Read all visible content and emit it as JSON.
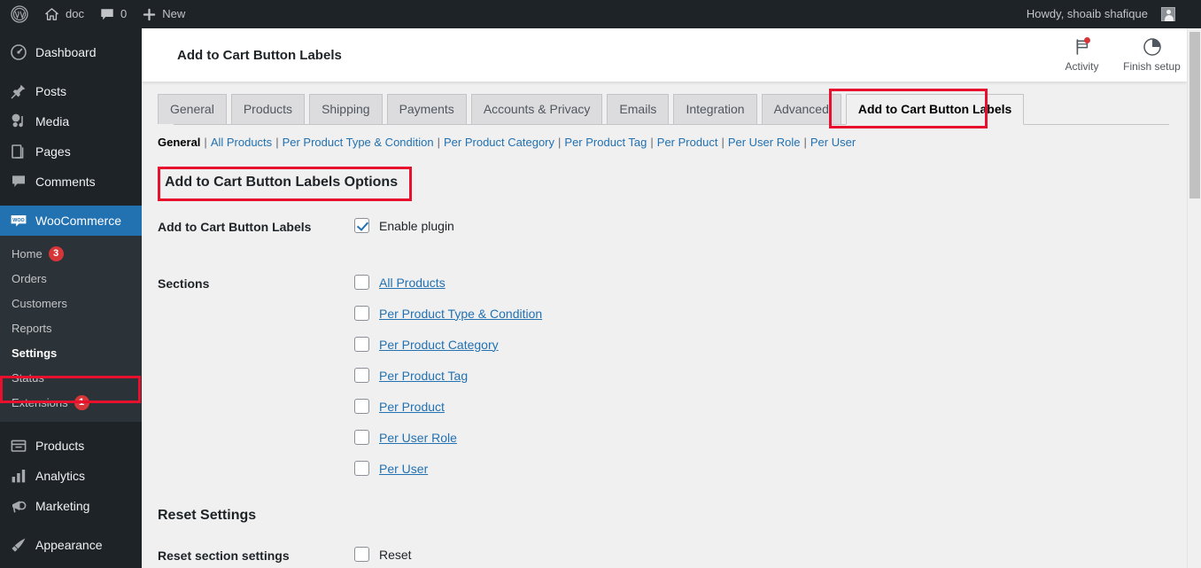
{
  "adminbar": {
    "logo_icon": "wordpress-logo-icon",
    "site_name": "doc",
    "comments_icon": "comment-bubble-icon",
    "comments_count": "0",
    "new_label": "New",
    "howdy": "Howdy, shoaib shafique",
    "avatar_icon": "user-avatar-icon"
  },
  "sidebar": {
    "items": [
      {
        "label": "Dashboard",
        "icon": "dashboard-icon"
      },
      {
        "label": "Posts",
        "icon": "pin-icon"
      },
      {
        "label": "Media",
        "icon": "media-icon"
      },
      {
        "label": "Pages",
        "icon": "pages-icon"
      },
      {
        "label": "Comments",
        "icon": "comment-bubble-icon"
      },
      {
        "label": "WooCommerce",
        "icon": "woocommerce-icon"
      }
    ],
    "submenu": [
      {
        "label": "Home",
        "badge": "3"
      },
      {
        "label": "Orders",
        "badge": ""
      },
      {
        "label": "Customers",
        "badge": ""
      },
      {
        "label": "Reports",
        "badge": ""
      },
      {
        "label": "Settings",
        "badge": ""
      },
      {
        "label": "Status",
        "badge": ""
      },
      {
        "label": "Extensions",
        "badge": "1"
      }
    ],
    "items_bottom": [
      {
        "label": "Products",
        "icon": "products-box-icon"
      },
      {
        "label": "Analytics",
        "icon": "bar-chart-icon"
      },
      {
        "label": "Marketing",
        "icon": "megaphone-icon"
      },
      {
        "label": "Appearance",
        "icon": "paintbrush-icon"
      }
    ]
  },
  "header": {
    "title": "Add to Cart Button Labels",
    "activity_label": "Activity",
    "activity_icon": "flag-icon",
    "finish_setup_label": "Finish setup",
    "finish_setup_icon": "pie-progress-icon"
  },
  "tabs": [
    {
      "label": "General",
      "active": false
    },
    {
      "label": "Products",
      "active": false
    },
    {
      "label": "Shipping",
      "active": false
    },
    {
      "label": "Payments",
      "active": false
    },
    {
      "label": "Accounts & Privacy",
      "active": false
    },
    {
      "label": "Emails",
      "active": false
    },
    {
      "label": "Integration",
      "active": false
    },
    {
      "label": "Advanced",
      "active": false
    },
    {
      "label": "Add to Cart Button Labels",
      "active": true
    }
  ],
  "subnav": [
    {
      "label": "General",
      "current": true
    },
    {
      "label": "All Products",
      "current": false
    },
    {
      "label": "Per Product Type & Condition",
      "current": false
    },
    {
      "label": "Per Product Category",
      "current": false
    },
    {
      "label": "Per Product Tag",
      "current": false
    },
    {
      "label": "Per Product",
      "current": false
    },
    {
      "label": "Per User Role",
      "current": false
    },
    {
      "label": "Per User",
      "current": false
    }
  ],
  "main": {
    "options_heading": "Add to Cart Button Labels Options",
    "enable_row_label": "Add to Cart Button Labels",
    "enable_checkbox_label": "Enable plugin",
    "enable_checked": true,
    "sections_row_label": "Sections",
    "sections": [
      {
        "label": "All Products",
        "checked": false
      },
      {
        "label": "Per Product Type & Condition",
        "checked": false
      },
      {
        "label": "Per Product Category",
        "checked": false
      },
      {
        "label": "Per Product Tag",
        "checked": false
      },
      {
        "label": "Per Product",
        "checked": false
      },
      {
        "label": "Per User Role",
        "checked": false
      },
      {
        "label": "Per User",
        "checked": false
      }
    ],
    "reset_heading": "Reset Settings",
    "reset_row_label": "Reset section settings",
    "reset_checkbox_label": "Reset",
    "reset_checked": false
  },
  "annotations": {
    "color": "#e8112d",
    "boxes": [
      "settings-menu-item",
      "active-tab",
      "options-heading"
    ]
  }
}
